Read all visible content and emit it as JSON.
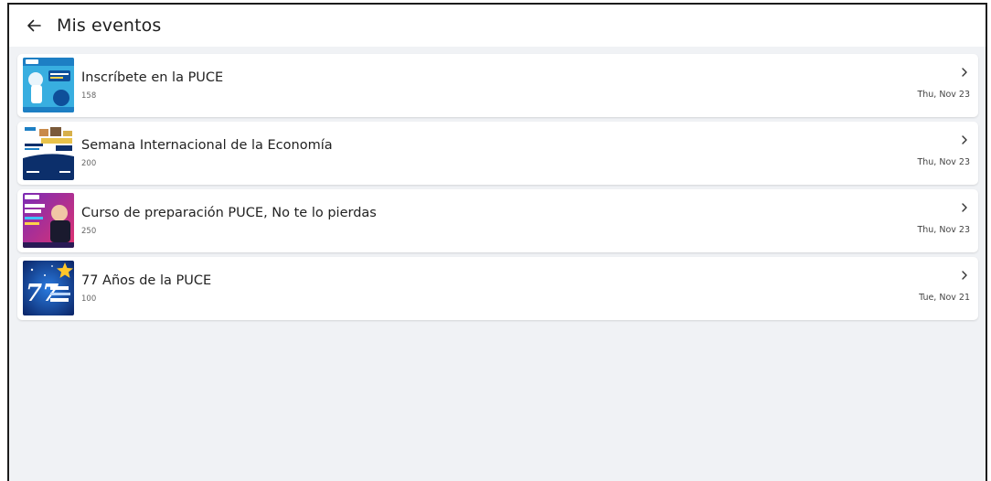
{
  "header": {
    "title": "Mis eventos",
    "back_icon": "arrow-left-icon"
  },
  "events": [
    {
      "title": "Inscríbete en la PUCE",
      "count": "158",
      "date": "Thu, Nov 23",
      "thumb_colors": [
        "#2fa6d9",
        "#0e4f9a"
      ]
    },
    {
      "title": "Semana Internacional de la Economía",
      "count": "200",
      "date": "Thu, Nov 23",
      "thumb_colors": [
        "#ffffff",
        "#0c2f6b"
      ]
    },
    {
      "title": "Curso de preparación PUCE, No te lo pierdas",
      "count": "250",
      "date": "Thu, Nov 23",
      "thumb_colors": [
        "#8e2bb0",
        "#e0336f"
      ]
    },
    {
      "title": "77 Años de la PUCE",
      "count": "100",
      "date": "Tue, Nov 21",
      "thumb_colors": [
        "#0c2f7a",
        "#1f6fd1"
      ]
    }
  ]
}
